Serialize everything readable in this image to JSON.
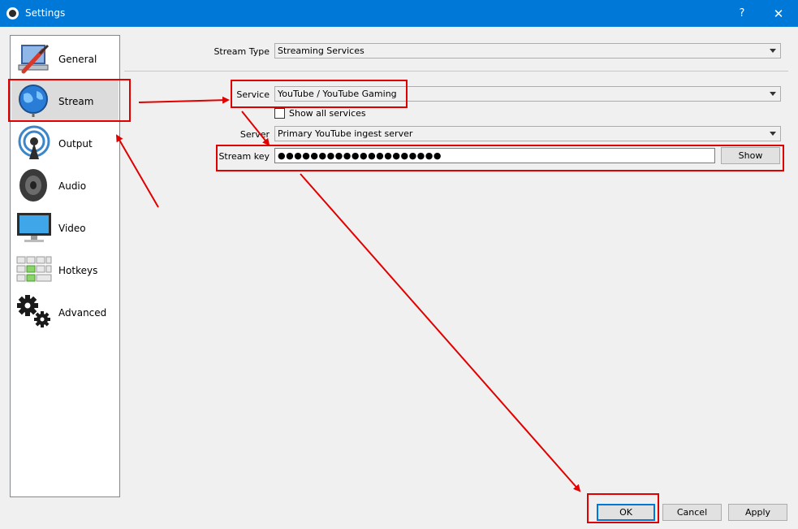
{
  "window": {
    "title": "Settings",
    "help_label": "?",
    "close_label": "✕"
  },
  "sidebar": {
    "items": [
      {
        "label": "General",
        "icon": "general-icon"
      },
      {
        "label": "Stream",
        "icon": "globe-icon",
        "selected": true
      },
      {
        "label": "Output",
        "icon": "broadcast-icon"
      },
      {
        "label": "Audio",
        "icon": "speaker-icon"
      },
      {
        "label": "Video",
        "icon": "monitor-icon"
      },
      {
        "label": "Hotkeys",
        "icon": "keyboard-icon"
      },
      {
        "label": "Advanced",
        "icon": "gears-icon"
      }
    ]
  },
  "stream": {
    "stream_type_label": "Stream Type",
    "stream_type_value": "Streaming Services",
    "service_label": "Service",
    "service_value": "YouTube / YouTube Gaming",
    "show_all_label": "Show all services",
    "show_all_checked": false,
    "server_label": "Server",
    "server_value": "Primary YouTube ingest server",
    "stream_key_label": "Stream key",
    "stream_key_value": "●●●●●●●●●●●●●●●●●●●●",
    "show_button": "Show"
  },
  "footer": {
    "ok": "OK",
    "cancel": "Cancel",
    "apply": "Apply"
  },
  "annotation": {
    "color": "#e00000"
  }
}
